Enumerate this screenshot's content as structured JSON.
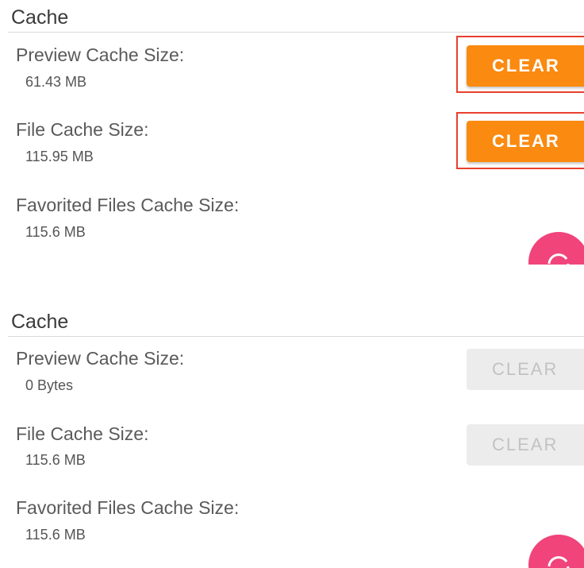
{
  "panels": [
    {
      "section_title": "Cache",
      "rows": [
        {
          "label": "Preview Cache Size:",
          "value": "61.43 MB",
          "button_label": "CLEAR",
          "button_enabled": true,
          "highlighted": true
        },
        {
          "label": "File Cache Size:",
          "value": "115.95 MB",
          "button_label": "CLEAR",
          "button_enabled": true,
          "highlighted": true
        },
        {
          "label": "Favorited Files Cache Size:",
          "value": "115.6 MB"
        }
      ]
    },
    {
      "section_title": "Cache",
      "rows": [
        {
          "label": "Preview Cache Size:",
          "value": "0 Bytes",
          "button_label": "CLEAR",
          "button_enabled": false
        },
        {
          "label": "File Cache Size:",
          "value": "115.6 MB",
          "button_label": "CLEAR",
          "button_enabled": false
        },
        {
          "label": "Favorited Files Cache Size:",
          "value": "115.6 MB"
        }
      ]
    }
  ],
  "colors": {
    "accent": "#fb8a10",
    "highlight": "#e8402f",
    "fab": "#f0447a",
    "disabled_bg": "#ececec",
    "disabled_text": "#c2c2c2"
  },
  "icons": {
    "fab": "sync-icon"
  }
}
